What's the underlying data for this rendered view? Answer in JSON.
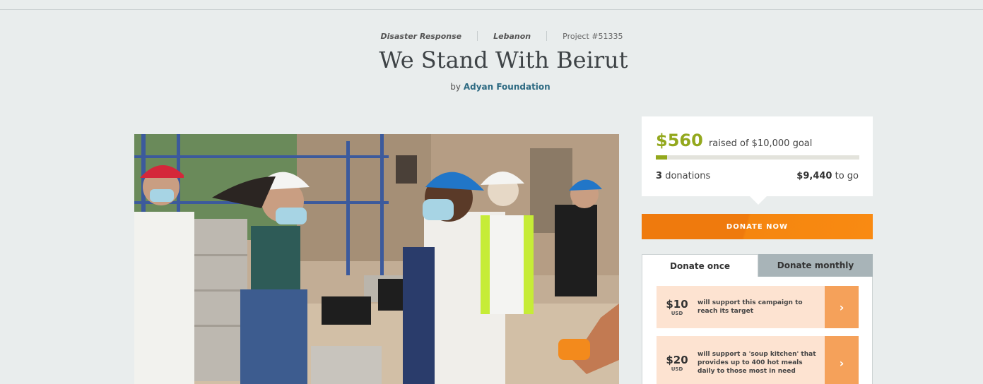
{
  "header": {
    "theme": "Disaster Response",
    "location": "Lebanon",
    "project_id": "Project #51335",
    "title": "We Stand With Beirut",
    "by_prefix": "by",
    "organization": "Adyan Foundation"
  },
  "progress": {
    "raised": "$560",
    "goal_text": "raised of $10,000 goal",
    "fraction": 0.056,
    "donation_count": "3",
    "donation_label": "donations",
    "to_go_amount": "$9,440",
    "to_go_label": "to go"
  },
  "donate_button": {
    "label": "DONATE NOW"
  },
  "tabs": [
    {
      "label": "Donate once",
      "active": true
    },
    {
      "label": "Donate monthly",
      "active": false
    }
  ],
  "options": [
    {
      "amount": "$10",
      "currency": "USD",
      "description": "will support this campaign to reach its target"
    },
    {
      "amount": "$20",
      "currency": "USD",
      "description": "will support a 'soup kitchen' that provides up to 400 hot meals daily to those most in need"
    }
  ],
  "colors": {
    "accent_green": "#93a81d",
    "donate_orange": "#ef7a0d",
    "link_blue": "#2d6a82",
    "option_bg": "#fde3d1",
    "option_arrow": "#f5a15a"
  },
  "photo": {
    "icon": "project-photo"
  }
}
